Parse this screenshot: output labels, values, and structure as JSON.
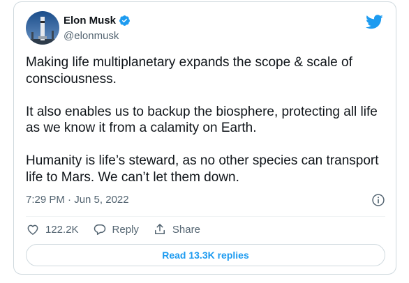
{
  "tweet": {
    "author_name": "Elon Musk",
    "handle": "@elonmusk",
    "paragraphs": [
      "Making life multiplanetary expands the scope & scale of consciousness.",
      "It also enables us to backup the biosphere, protecting all life as we know it from a calamity on Earth.",
      "Humanity is life’s steward, as no other species can transport life to Mars. We can’t let them down."
    ],
    "timestamp": "7:29 PM · Jun 5, 2022"
  },
  "actions": {
    "likes": "122.2K",
    "reply_label": "Reply",
    "share_label": "Share"
  },
  "read_replies_label": "Read 13.3K replies",
  "icons": {
    "verified": "verified-badge-icon",
    "brand": "twitter-bird-icon",
    "info": "info-icon",
    "like": "heart-icon",
    "reply": "reply-bubble-icon",
    "share": "share-upload-icon"
  },
  "colors": {
    "accent": "#1d9bf0",
    "text": "#0f1419",
    "muted": "#536471",
    "border": "#cfd9de"
  }
}
